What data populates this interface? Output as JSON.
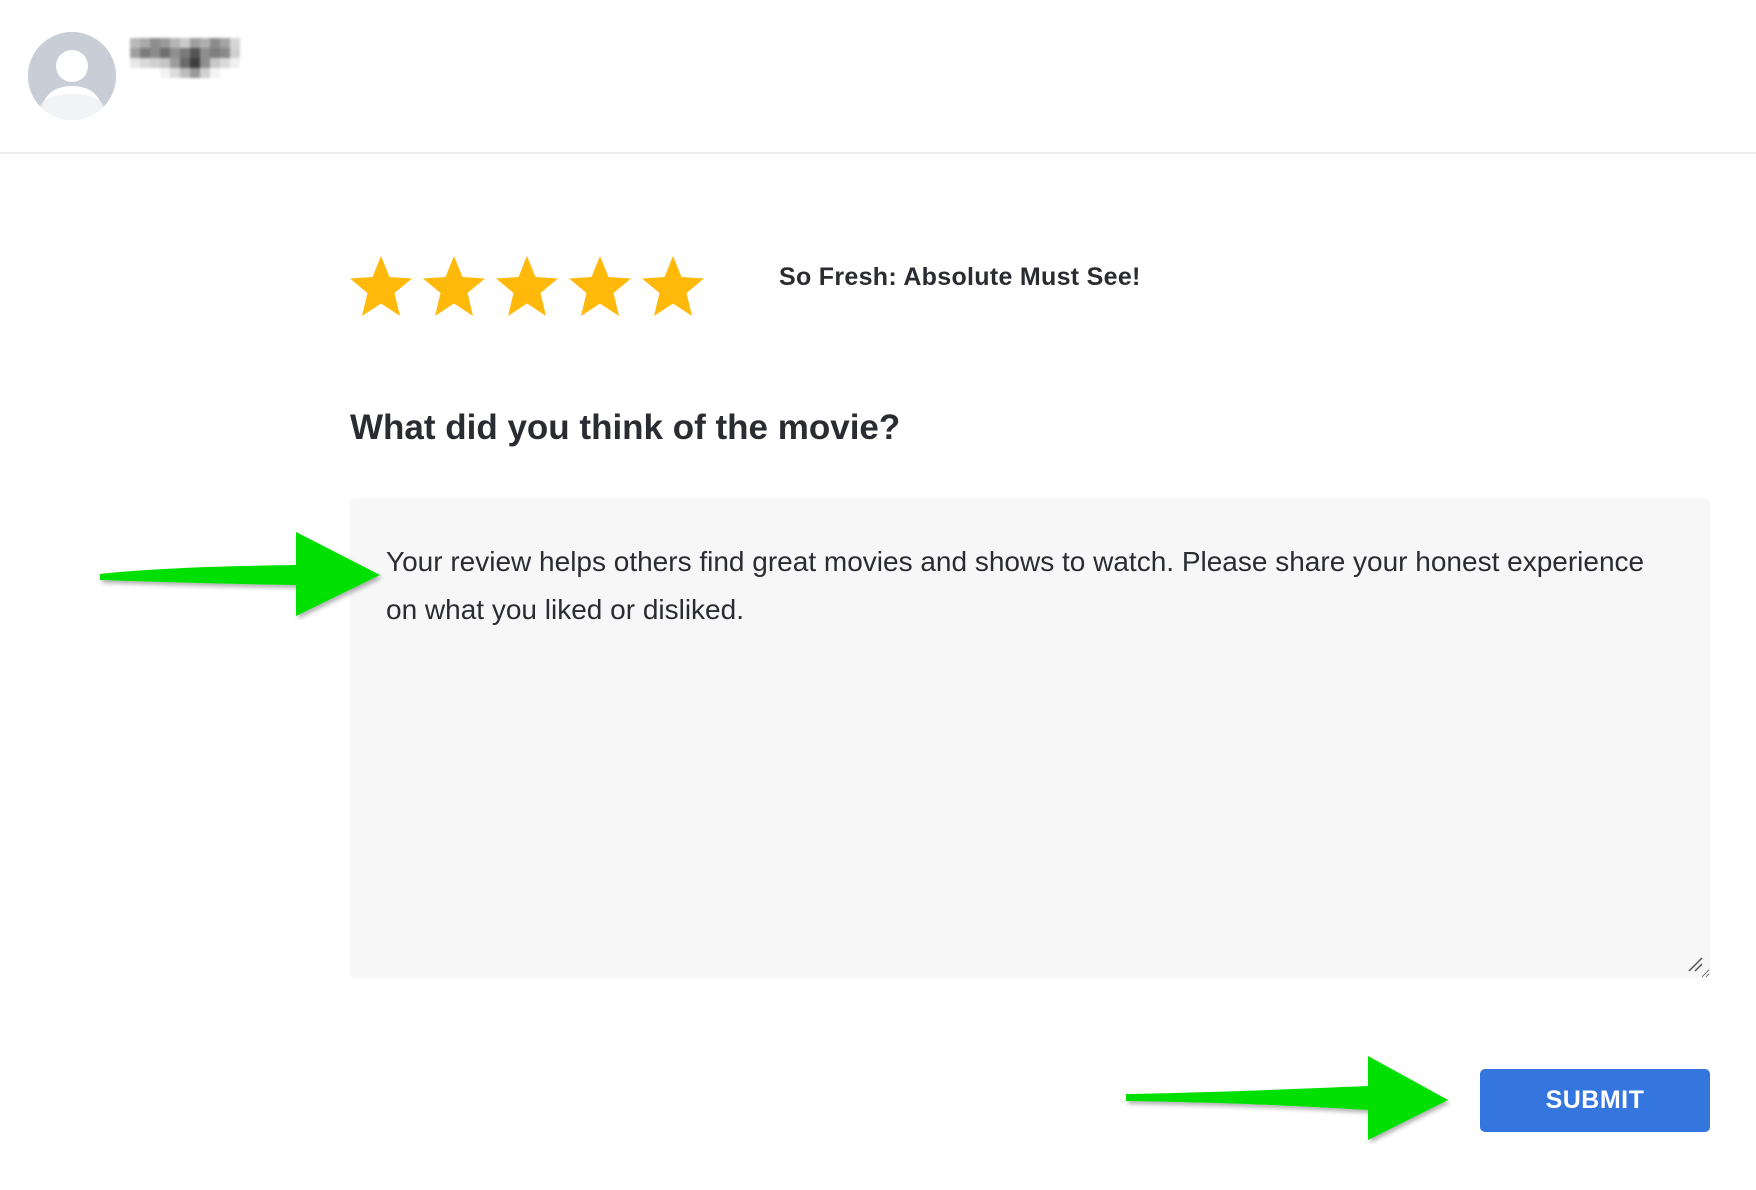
{
  "header": {
    "avatar_icon": "user-avatar-icon",
    "username": "",
    "username_pixel_colors": [
      [
        "#b9b9b9",
        "#a9a9a9",
        "#8e8e8e",
        "#9a9a9a",
        "#b4b4b4",
        "#c9c9c9",
        "#9e9e9e",
        "#b0b0b0",
        "#8c8c8c",
        "#a4a4a4",
        "#d6d6d6"
      ],
      [
        "#a0a0a0",
        "#7c7c7c",
        "#8b8b8b",
        "#6f6f6f",
        "#8f8f8f",
        "#7a7a7a",
        "#555555",
        "#8d8d8d",
        "#7e7e7e",
        "#8a8a8a",
        "#cfcfcf"
      ],
      [
        "#e8e8e8",
        "#d9d9d9",
        "#cfcfcf",
        "#c5c5c5",
        "#9d9d9d",
        "#6a6a6a",
        "#3f3f3f",
        "#8f8f8f",
        "#c8c8c8",
        "#d9d9d9",
        "#f0f0f0"
      ],
      [
        "#ffffff",
        "#ffffff",
        "#ffffff",
        "#f3f3f3",
        "#dcdcdc",
        "#bcbcbc",
        "#9a9a9a",
        "#d0d0d0",
        "#f4f4f4",
        "#ffffff",
        "#ffffff"
      ]
    ]
  },
  "rating": {
    "stars_selected": 5,
    "stars_total": 5,
    "star_color": "#ffb90b",
    "label": "So Fresh: Absolute Must See!"
  },
  "review": {
    "question": "What did you think of the movie?",
    "placeholder": "Your review helps others find great movies and shows to watch. Please share your honest experience on what you liked or disliked.",
    "value": ""
  },
  "actions": {
    "submit_label": "SUBMIT",
    "submit_color": "#3476dd"
  },
  "annotations": {
    "arrow_color": "#00e000"
  }
}
